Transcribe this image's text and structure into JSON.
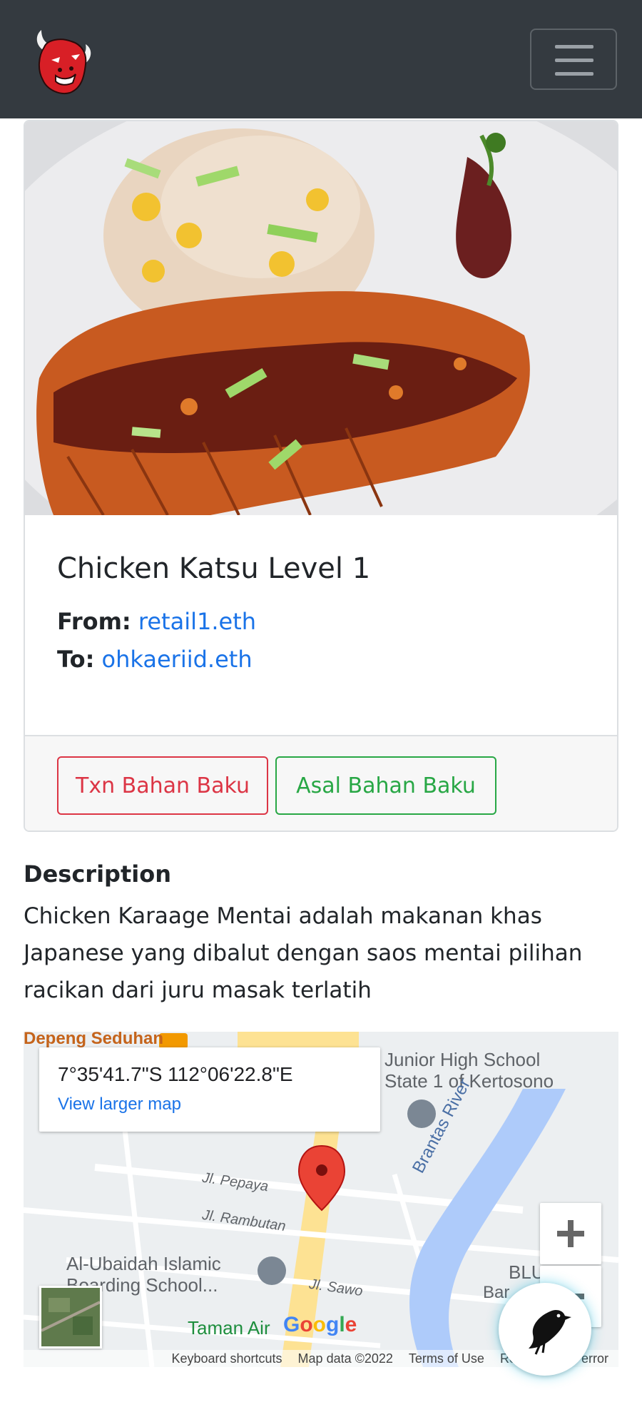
{
  "navbar": {
    "logo": "bull-logo",
    "toggler_icon": "hamburger-icon"
  },
  "product": {
    "image": "chicken-katsu-photo",
    "title": "Chicken Katsu Level 1",
    "from_label": "From:",
    "from_value": "retail1.eth",
    "to_label": "To:",
    "to_value": "ohkaeriid.eth",
    "buttons": {
      "txn_label": "Txn Bahan Baku",
      "origin_label": "Asal Bahan Baku"
    }
  },
  "description": {
    "title": "Description",
    "text": "Chicken Karaage Mentai adalah makanan khas Japanese yang dibalut dengan saos mentai pilihan racikan dari juru masak terlatih"
  },
  "map": {
    "coords": "7°35'41.7\"S 112°06'22.8\"E",
    "larger_map_link": "View larger map",
    "labels": {
      "top_left": "Depeng Seduhan",
      "school": "Junior High School State 1 of Kertosono",
      "river": "Brantas River",
      "street1": "Jl. Pepaya",
      "street2": "Jl. Rambutan",
      "islamic": "Al-Ubaidah Islamic Boarding School...",
      "street3": "Jl. Sawo",
      "park": "Taman Air",
      "blu": "BLU",
      "bar": "Bar"
    },
    "zoom_in": "+",
    "zoom_out": "−",
    "google": "Google",
    "footer": {
      "shortcuts": "Keyboard shortcuts",
      "mapdata": "Map data ©2022",
      "terms": "Terms of Use",
      "report": "Report a map error"
    }
  },
  "fab": {
    "icon": "bird-icon"
  }
}
